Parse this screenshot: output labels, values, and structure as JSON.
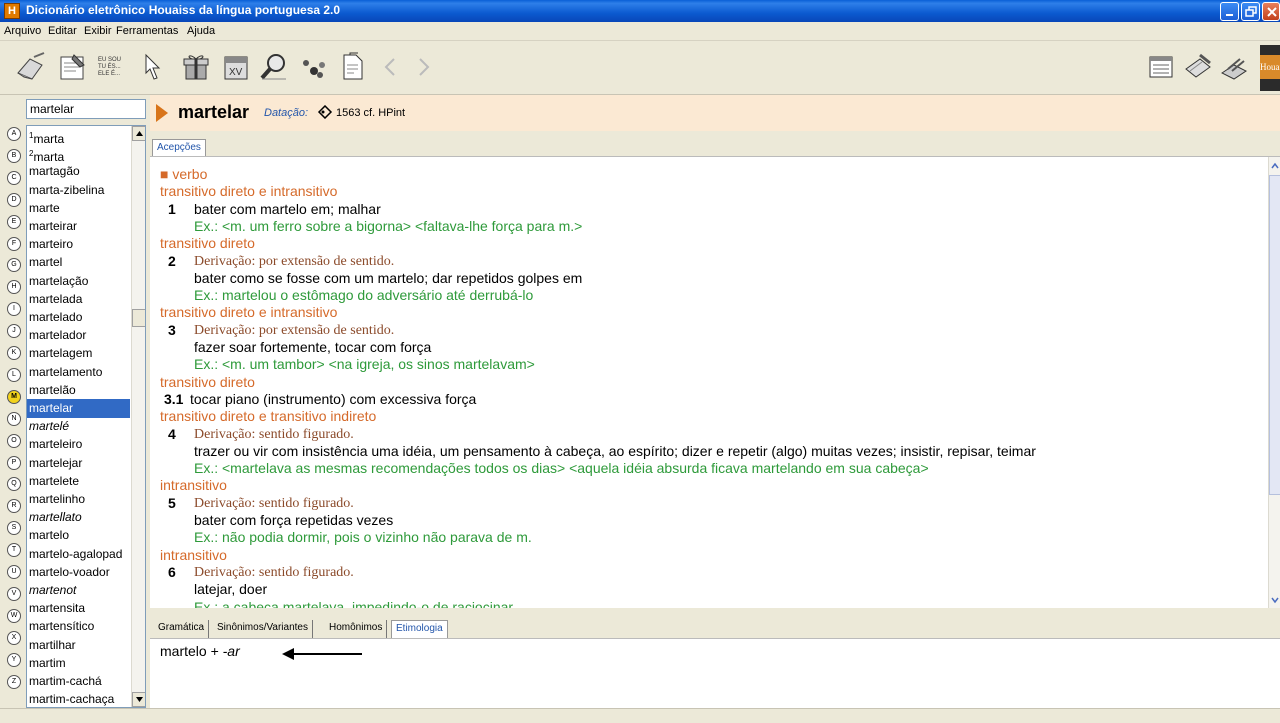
{
  "window": {
    "title": "Dicionário eletrônico Houaiss da língua portuguesa 2.0",
    "app_icon_letter": "H"
  },
  "menu": [
    "Arquivo",
    "Editar",
    "Exibir",
    "Ferramentas",
    "Ajuda"
  ],
  "toolbar": {
    "icons": [
      "eraser-icon",
      "notebook-icon",
      "eu-sou-conjugation-icon",
      "cursor-icon",
      "gift-icon",
      "calendar-icon",
      "search-zoom-icon",
      "dots-icon",
      "document-icon",
      "back-arrow-icon",
      "forward-arrow-icon"
    ],
    "eu_sou_text": "EU SOU TU ÉS ELE É",
    "right_icons": [
      "list-view-icon",
      "book-pen-icon",
      "print-icon"
    ],
    "logo_text": "Houaiss"
  },
  "search": {
    "value": "martelar"
  },
  "alphabet": [
    "A",
    "B",
    "C",
    "D",
    "E",
    "F",
    "G",
    "H",
    "I",
    "J",
    "K",
    "L",
    "M",
    "N",
    "O",
    "P",
    "Q",
    "R",
    "S",
    "T",
    "U",
    "V",
    "W",
    "X",
    "Y",
    "Z"
  ],
  "active_letter": "M",
  "wordlist": [
    {
      "sup": "1",
      "word": "marta"
    },
    {
      "sup": "2",
      "word": "marta"
    },
    {
      "word": "martagão"
    },
    {
      "word": "marta-zibelina"
    },
    {
      "word": "marte"
    },
    {
      "word": "marteirar"
    },
    {
      "word": "marteiro"
    },
    {
      "word": "martel"
    },
    {
      "word": "martelação"
    },
    {
      "word": "martelada"
    },
    {
      "word": "martelado"
    },
    {
      "word": "martelador"
    },
    {
      "word": "martelagem"
    },
    {
      "word": "martelamento"
    },
    {
      "word": "martelão"
    },
    {
      "word": "martelar",
      "selected": true
    },
    {
      "word": "martelé",
      "italic": true
    },
    {
      "word": "marteleiro"
    },
    {
      "word": "martelejar"
    },
    {
      "word": "martelete"
    },
    {
      "word": "martelinho"
    },
    {
      "word": "martellato",
      "italic": true
    },
    {
      "word": "martelo"
    },
    {
      "word": "martelo-agalopad"
    },
    {
      "word": "martelo-voador"
    },
    {
      "word": "martenot",
      "italic": true
    },
    {
      "word": "martensita"
    },
    {
      "word": "martensítico"
    },
    {
      "word": "martilhar"
    },
    {
      "word": "martim"
    },
    {
      "word": "martim-cachá"
    },
    {
      "word": "martim-cachaça"
    }
  ],
  "entry": {
    "headword": "martelar",
    "datacao_label": "Datação:",
    "datacao_value": "1563 cf. HPint"
  },
  "top_tabs": [
    "Acepções"
  ],
  "definition_lines": [
    {
      "t": "gram",
      "text": "■ verbo"
    },
    {
      "t": "gram",
      "text": "transitivo direto e intransitivo"
    },
    {
      "t": "sense",
      "num": "1",
      "text": "bater com martelo em; malhar"
    },
    {
      "t": "ex",
      "text": "Ex.: <m. um ferro sobre a bigorna> <faltava-lhe força para m.>"
    },
    {
      "t": "gram",
      "text": "transitivo direto"
    },
    {
      "t": "deriv",
      "num": "2",
      "text": "Derivação: por extensão de sentido."
    },
    {
      "t": "sense",
      "text": "bater como se fosse com um martelo; dar repetidos golpes em"
    },
    {
      "t": "ex",
      "text": "Ex.: martelou o estômago do adversário até derrubá-lo"
    },
    {
      "t": "gram",
      "text": "transitivo direto e intransitivo"
    },
    {
      "t": "deriv",
      "num": "3",
      "text": "Derivação: por extensão de sentido."
    },
    {
      "t": "sense",
      "text": "fazer soar fortemente, tocar com força"
    },
    {
      "t": "ex",
      "text": "Ex.: <m. um tambor> <na igreja, os sinos martelavam>"
    },
    {
      "t": "gram",
      "text": "transitivo direto"
    },
    {
      "t": "sense",
      "num": "3.1",
      "text": "tocar piano (instrumento) com excessiva força"
    },
    {
      "t": "gram",
      "text": "transitivo direto e transitivo indireto"
    },
    {
      "t": "deriv",
      "num": "4",
      "text": "Derivação: sentido figurado."
    },
    {
      "t": "sense",
      "text": "trazer ou vir com insistência uma idéia, um pensamento à cabeça, ao espírito; dizer e repetir (algo) muitas vezes; insistir, repisar, teimar"
    },
    {
      "t": "ex",
      "text": "Ex.: <martelava as mesmas recomendações todos os dias> <aquela idéia absurda ficava martelando em sua cabeça>"
    },
    {
      "t": "gram",
      "text": "intransitivo"
    },
    {
      "t": "deriv",
      "num": "5",
      "text": "Derivação: sentido figurado."
    },
    {
      "t": "sense",
      "text": "bater com força repetidas vezes"
    },
    {
      "t": "ex",
      "text": "Ex.: não podia dormir, pois o vizinho não parava de m."
    },
    {
      "t": "gram",
      "text": "intransitivo"
    },
    {
      "t": "deriv",
      "num": "6",
      "text": "Derivação: sentido figurado."
    },
    {
      "t": "sense",
      "text": "latejar, doer"
    },
    {
      "t": "ex",
      "text": "Ex.: a cabeça martelava, impedindo-o de raciocinar"
    }
  ],
  "bottom_tabs": [
    "Gramática",
    "Sinônimos/Variantes",
    "Homônimos",
    "Etimologia"
  ],
  "active_bottom_tab": "Etimologia",
  "etymology": {
    "base": "martelo + ",
    "suffix": "-ar"
  },
  "colors": {
    "gram": "#d56a2a",
    "example": "#2e9a3a",
    "derivation": "#8b4a2a",
    "selection": "#316ac5",
    "headbar": "#fbe9d3"
  }
}
